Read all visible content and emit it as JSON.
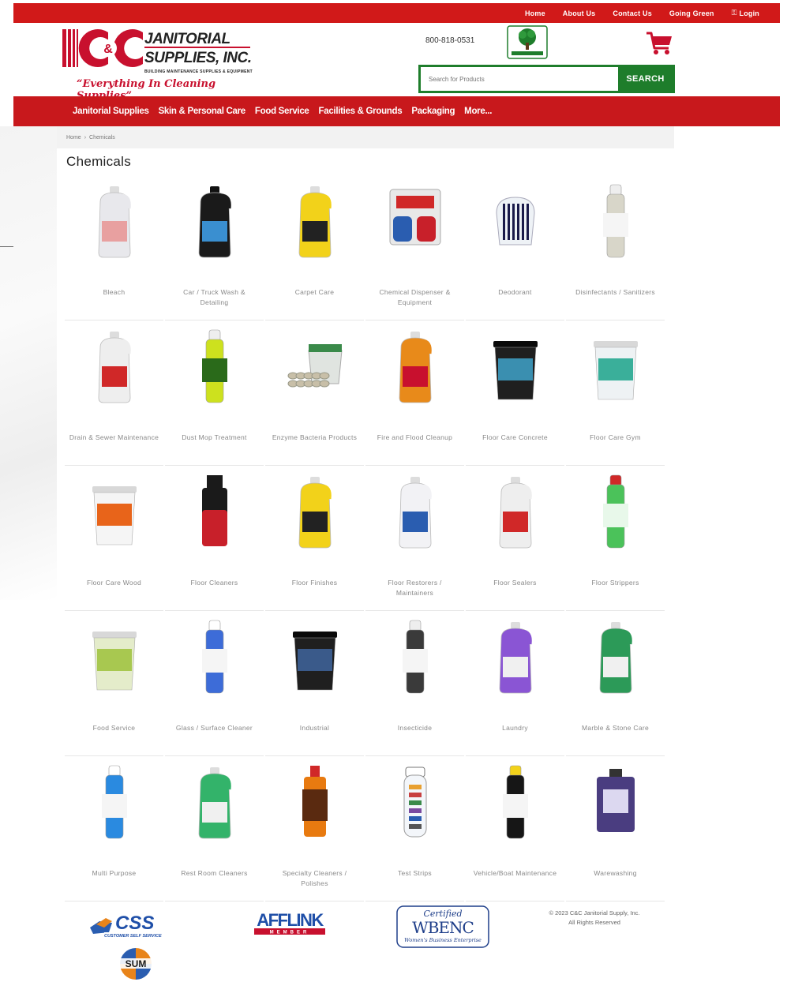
{
  "topnav": {
    "home": "Home",
    "about": "About Us",
    "contact": "Contact Us",
    "green": "Going Green",
    "login": "Login"
  },
  "header": {
    "logo_line1": "JANITORIAL",
    "logo_line2": "SUPPLIES, INC.",
    "logo_subline": "BUILDING MAINTENANCE SUPPLIES & EQUIPMENT",
    "logo_tagline": "“Everything In Cleaning Supplies”",
    "phone": "800-818-0531",
    "search_placeholder": "Search for Products",
    "search_button": "SEARCH"
  },
  "mainnav": {
    "items": [
      "Janitorial Supplies",
      "Skin & Personal Care",
      "Food Service",
      "Facilities & Grounds",
      "Packaging",
      "More..."
    ]
  },
  "breadcrumb": {
    "home": "Home",
    "sep": "›",
    "current": "Chemicals"
  },
  "page_title": "Chemicals",
  "categories": [
    {
      "label": "Bleach",
      "icon": "white-jug",
      "color": "#e8e8ec"
    },
    {
      "label": "Car / Truck Wash & Detailing",
      "icon": "black-jug",
      "color": "#1a1a1a"
    },
    {
      "label": "Carpet Care",
      "icon": "yellow-jug",
      "color": "#f2d21a"
    },
    {
      "label": "Chemical Dispenser & Equipment",
      "icon": "dispenser",
      "color": "#e0e0e0"
    },
    {
      "label": "Deodorant",
      "icon": "urinal-screen",
      "color": "#dfe4ea"
    },
    {
      "label": "Disinfectants / Sanitizers",
      "icon": "spray-can",
      "color": "#d8d6c9"
    },
    {
      "label": "Drain & Sewer Maintenance",
      "icon": "white-jug-red",
      "color": "#eeeeee"
    },
    {
      "label": "Dust Mop Treatment",
      "icon": "yellow-can",
      "color": "#cde11e"
    },
    {
      "label": "Enzyme Bacteria Products",
      "icon": "tub",
      "color": "#d9dfd9"
    },
    {
      "label": "Fire and Flood Cleanup",
      "icon": "orange-jug",
      "color": "#e88a1a"
    },
    {
      "label": "Floor Care Concrete",
      "icon": "black-pail",
      "color": "#1f1f1f"
    },
    {
      "label": "Floor Care Gym",
      "icon": "white-pail",
      "color": "#eef2f4"
    },
    {
      "label": "Floor Care Wood",
      "icon": "white-pail-orange",
      "color": "#f5f5f5"
    },
    {
      "label": "Floor Cleaners",
      "icon": "red-bottle",
      "color": "#c8202a"
    },
    {
      "label": "Floor Finishes",
      "icon": "yellow-jug",
      "color": "#f2d21a"
    },
    {
      "label": "Floor Restorers / Maintainers",
      "icon": "white-jug-blue",
      "color": "#f2f2f5"
    },
    {
      "label": "Floor Sealers",
      "icon": "white-jug-red",
      "color": "#eeeeee"
    },
    {
      "label": "Floor Strippers",
      "icon": "green-can",
      "color": "#4bc25a"
    },
    {
      "label": "Food Service",
      "icon": "green-pail",
      "color": "#e4ecca"
    },
    {
      "label": "Glass / Surface Cleaner",
      "icon": "blue-can",
      "color": "#3d6cd8"
    },
    {
      "label": "Industrial",
      "icon": "black-pail-blue",
      "color": "#1f1f1f"
    },
    {
      "label": "Insecticide",
      "icon": "dark-can",
      "color": "#3a3a3a"
    },
    {
      "label": "Laundry",
      "icon": "purple-jug",
      "color": "#8a55d4"
    },
    {
      "label": "Marble & Stone Care",
      "icon": "green-jug",
      "color": "#2c9a58"
    },
    {
      "label": "Multi Purpose",
      "icon": "blue-can",
      "color": "#2a8ae0"
    },
    {
      "label": "Rest Room Cleaners",
      "icon": "green-jug",
      "color": "#33b36a"
    },
    {
      "label": "Specialty Cleaners / Polishes",
      "icon": "orange-bottle",
      "color": "#e87a10"
    },
    {
      "label": "Test Strips",
      "icon": "test-tube",
      "color": "#dfe6ef"
    },
    {
      "label": "Vehicle/Boat Maintenance",
      "icon": "black-yellow-can",
      "color": "#161616"
    },
    {
      "label": "Warewashing",
      "icon": "purple-cube",
      "color": "#4a3d80"
    }
  ],
  "footer": {
    "css_text": "CSS",
    "css_sub": "CUSTOMER SELF SERVICE",
    "afflink_text": "AFFLINK",
    "afflink_sub": "MEMBER",
    "wbenc_certified": "Certified",
    "wbenc_text": "WBENC",
    "wbenc_sub": "Women's Business Enterprise",
    "sum_text": "SUM",
    "copyright_line1": "© 2023 C&C Janitorial Supply, Inc.",
    "copyright_line2": "All Rights Reserved"
  }
}
